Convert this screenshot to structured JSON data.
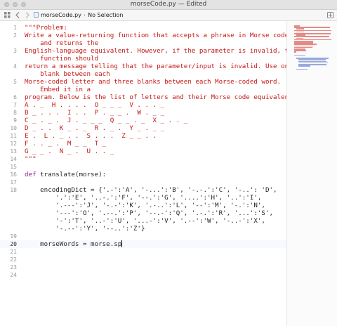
{
  "window": {
    "title": "morseCode.py — Edited"
  },
  "jumpbar": {
    "file": "morseCode.py",
    "selection": "No Selection",
    "icons": [
      "grid-icon",
      "back-icon",
      "forward-icon",
      "file-icon",
      "add-editor-icon"
    ]
  },
  "editor": {
    "current_line": "20",
    "lines": [
      {
        "n": "1",
        "text": "\"\"\"Problem:",
        "kind": "str"
      },
      {
        "n": "2",
        "text": "Write a value-returning function that accepts a phrase in Morse code",
        "kind": "str"
      },
      {
        "n": "",
        "text": "    and returns the",
        "kind": "str"
      },
      {
        "n": "3",
        "text": "English-language equivalent. However, if the parameter is invalid, the",
        "kind": "str"
      },
      {
        "n": "",
        "text": "    function should",
        "kind": "str"
      },
      {
        "n": "4",
        "text": "return a message telling that the parameter/input is invalid. Use one",
        "kind": "str"
      },
      {
        "n": "",
        "text": "    blank between each",
        "kind": "str"
      },
      {
        "n": "5",
        "text": "Morse-coded letter and three blanks between each Morse-coded word.",
        "kind": "str"
      },
      {
        "n": "",
        "text": "    Embed it in a",
        "kind": "str"
      },
      {
        "n": "6",
        "text": "program. Below is the list of letters and their Morse code equivalent.",
        "kind": "str"
      },
      {
        "n": "7",
        "text": "A . _  H . . . .  O _ _ _  V . . . _",
        "kind": "str"
      },
      {
        "n": "8",
        "text": "B _ . . .  I . .  P . _ _ .  W . _ _",
        "kind": "str"
      },
      {
        "n": "9",
        "text": "C _ . _ .  J . _ _ _  Q _ _ . _  X _ . . _",
        "kind": "str"
      },
      {
        "n": "10",
        "text": "D _ . .  K _ . _  R . _ .  Y _ . _ _",
        "kind": "str"
      },
      {
        "n": "11",
        "text": "E .  L . _ . .  S . . .  Z _ _ . .",
        "kind": "str"
      },
      {
        "n": "12",
        "text": "F . . _ .  M _ _  T _",
        "kind": "str"
      },
      {
        "n": "13",
        "text": "G _ _ .  N _ .  U . . _",
        "kind": "str"
      },
      {
        "n": "14",
        "text": "\"\"\"",
        "kind": "str"
      },
      {
        "n": "15",
        "text": "",
        "kind": "plain"
      },
      {
        "n": "16",
        "text": "def translate(morse):",
        "kind": "def"
      },
      {
        "n": "17",
        "text": "",
        "kind": "plain"
      },
      {
        "n": "18",
        "text": "    encodingDict = {'.-':'A', '-...':'B', '-.-.':'C', '-..': 'D',",
        "kind": "plain"
      },
      {
        "n": "",
        "text": "        '.':'E', '..-.':'F', '--.':'G', '....':'H', '..':'I',",
        "kind": "plain"
      },
      {
        "n": "",
        "text": "        '.---':'J', '-.-':'K', '.-..':'L', '--':'M', '-.':'N',",
        "kind": "plain"
      },
      {
        "n": "",
        "text": "        '---':'O', '.--.':'P', '--.-':'Q', '.-.':'R', '...':'S',",
        "kind": "plain"
      },
      {
        "n": "",
        "text": "        '-':'T', '..-':'U', '...-':'V', '.--':'W', '-..-':'X',",
        "kind": "plain"
      },
      {
        "n": "",
        "text": "        '-.--':'Y', '--..':'Z'}",
        "kind": "plain"
      },
      {
        "n": "19",
        "text": "",
        "kind": "plain"
      },
      {
        "n": "20",
        "text": "    morseWords = morse.sp",
        "kind": "cursor"
      },
      {
        "n": "21",
        "text": "",
        "kind": "plain"
      },
      {
        "n": "22",
        "text": "",
        "kind": "plain"
      },
      {
        "n": "23",
        "text": "",
        "kind": "plain"
      },
      {
        "n": "24",
        "text": "",
        "kind": "plain"
      }
    ]
  }
}
